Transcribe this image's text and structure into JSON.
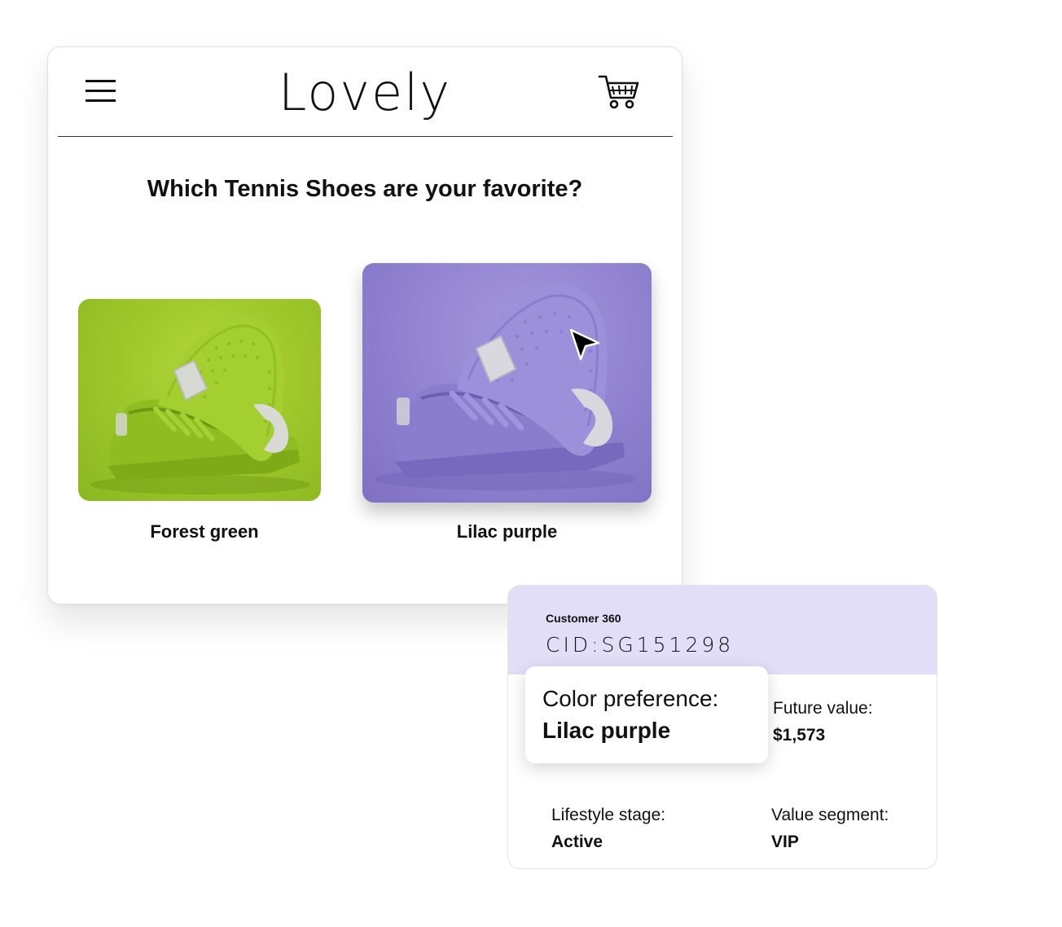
{
  "store": {
    "brand": "Lovely",
    "question": "Which Tennis Shoes are your favorite?",
    "products": [
      {
        "label": "Forest green",
        "color": "#9cc52a"
      },
      {
        "label": "Lilac purple",
        "color": "#8f81cf"
      }
    ]
  },
  "customer360": {
    "title": "Customer 360",
    "cid": "CID:SG151298",
    "color_preference": {
      "label": "Color preference:",
      "value": "Lilac purple"
    },
    "future_value": {
      "label": "Future value:",
      "value": "$1,573"
    },
    "lifestyle_stage": {
      "label": "Lifestyle stage:",
      "value": "Active"
    },
    "value_segment": {
      "label": "Value segment:",
      "value": "VIP"
    },
    "header_color": "#e3def8"
  }
}
